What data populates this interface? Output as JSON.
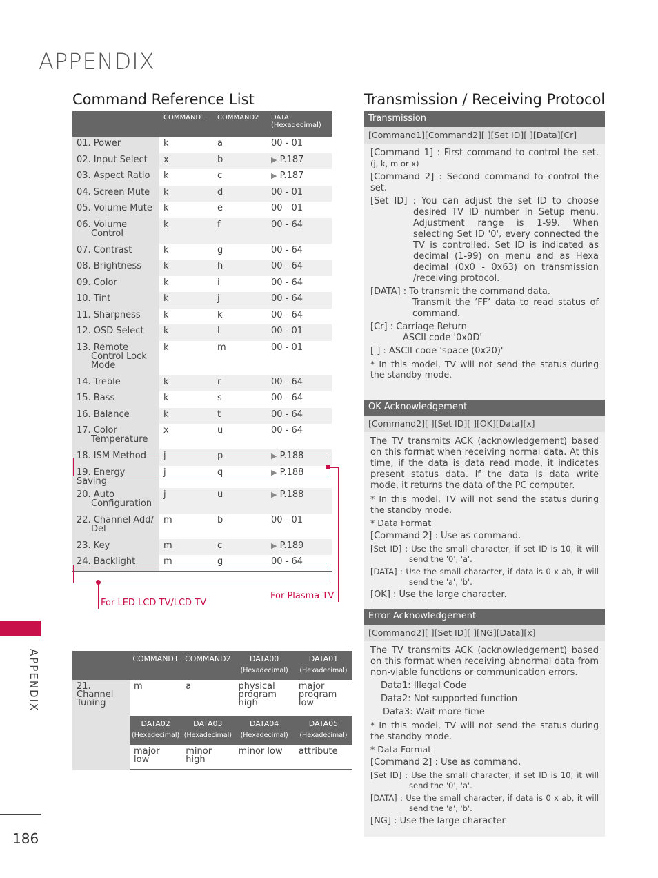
{
  "page": {
    "title": "APPENDIX",
    "side_tab": "APPENDIX",
    "page_number": "186",
    "accent_color": "#c8104a"
  },
  "command_reference": {
    "title": "Command Reference List",
    "headers": [
      "",
      "COMMAND1",
      "COMMAND2",
      "DATA",
      "(Hexadecimal)"
    ],
    "rows": [
      {
        "name": "01. Power",
        "cont": "",
        "c1": "k",
        "c2": "a",
        "data": "00 - 01",
        "ref": false
      },
      {
        "name": "02. Input Select",
        "cont": "",
        "c1": "x",
        "c2": "b",
        "data": "P.187",
        "ref": true
      },
      {
        "name": "03. Aspect Ratio",
        "cont": "",
        "c1": "k",
        "c2": "c",
        "data": "P.187",
        "ref": true
      },
      {
        "name": "04. Screen Mute",
        "cont": "",
        "c1": "k",
        "c2": "d",
        "data": "00 - 01",
        "ref": false
      },
      {
        "name": "05. Volume Mute",
        "cont": "",
        "c1": "k",
        "c2": "e",
        "data": "00 - 01",
        "ref": false
      },
      {
        "name": "06. Volume",
        "cont": "Control",
        "c1": "k",
        "c2": "f",
        "data": "00 - 64",
        "ref": false
      },
      {
        "name": "07. Contrast",
        "cont": "",
        "c1": "k",
        "c2": "g",
        "data": "00 - 64",
        "ref": false
      },
      {
        "name": "08. Brightness",
        "cont": "",
        "c1": "k",
        "c2": "h",
        "data": "00 - 64",
        "ref": false
      },
      {
        "name": "09. Color",
        "cont": "",
        "c1": "k",
        "c2": "i",
        "data": "00 - 64",
        "ref": false
      },
      {
        "name": "10. Tint",
        "cont": "",
        "c1": "k",
        "c2": "j",
        "data": "00 - 64",
        "ref": false
      },
      {
        "name": "11. Sharpness",
        "cont": "",
        "c1": "k",
        "c2": "k",
        "data": "00 - 64",
        "ref": false
      },
      {
        "name": "12. OSD Select",
        "cont": "",
        "c1": "k",
        "c2": "l",
        "data": "00 - 01",
        "ref": false
      },
      {
        "name": "13. Remote",
        "cont": "Control Lock Mode",
        "c1": "k",
        "c2": "m",
        "data": "00 - 01",
        "ref": false
      },
      {
        "name": "14. Treble",
        "cont": "",
        "c1": "k",
        "c2": "r",
        "data": "00 - 64",
        "ref": false
      },
      {
        "name": "15. Bass",
        "cont": "",
        "c1": "k",
        "c2": "s",
        "data": "00 - 64",
        "ref": false
      },
      {
        "name": "16. Balance",
        "cont": "",
        "c1": "k",
        "c2": "t",
        "data": "00 - 64",
        "ref": false
      },
      {
        "name": "17. Color",
        "cont": "Temperature",
        "c1": "x",
        "c2": "u",
        "data": "00 - 64",
        "ref": false
      },
      {
        "name": "18. ISM Method",
        "cont": "",
        "c1": "j",
        "c2": "p",
        "data": "P.188",
        "ref": true
      },
      {
        "name": "19. Energy Saving",
        "cont": "",
        "c1": "j",
        "c2": "q",
        "data": "P.188",
        "ref": true
      },
      {
        "name": "20. Auto",
        "cont": "Configuration",
        "c1": "j",
        "c2": "u",
        "data": "P.188",
        "ref": true
      },
      {
        "name": "22. Channel Add/",
        "cont": "Del",
        "c1": "m",
        "c2": "b",
        "data": "00 - 01",
        "ref": false
      },
      {
        "name": "23. Key",
        "cont": "",
        "c1": "m",
        "c2": "c",
        "data": "P.189",
        "ref": true
      },
      {
        "name": "24. Backlight",
        "cont": "",
        "c1": "m",
        "c2": "g",
        "data": "00 - 64",
        "ref": false
      }
    ],
    "note_led": "For LED LCD TV/LCD TV",
    "note_plasma": "For Plasma TV",
    "arrow_glyph": "▶"
  },
  "channel_tuning": {
    "name_lines": [
      "21.",
      "Channel",
      "Tuning"
    ],
    "headers_top": [
      {
        "label": "COMMAND1",
        "sub": ""
      },
      {
        "label": "COMMAND2",
        "sub": ""
      },
      {
        "label": "DATA00",
        "sub": "(Hexadecimal)"
      },
      {
        "label": "DATA01",
        "sub": "(Hexadecimal)"
      }
    ],
    "row_top": [
      "m",
      "a",
      "physical program high",
      "major program low"
    ],
    "headers_bottom": [
      {
        "label": "DATA02",
        "sub": "(Hexadecimal)"
      },
      {
        "label": "DATA03",
        "sub": "(Hexadecimal)"
      },
      {
        "label": "DATA04",
        "sub": "(Hexadecimal)"
      },
      {
        "label": "DATA05",
        "sub": "(Hexadecimal)"
      }
    ],
    "row_bottom": [
      "major low",
      "minor high",
      "minor low",
      "attribute"
    ]
  },
  "protocol": {
    "title": "Transmission / Receiving Protocol",
    "transmission": {
      "header": "Transmission",
      "format": "[Command1][Command2][   ][Set ID][   ][Data][Cr]",
      "cmd1": "[Command 1] : First command to control the set.",
      "cmd1_small": "(j, k, m or x)",
      "cmd2": "[Command 2] : Second command to control the set.",
      "setid": "[Set ID] : You can adjust the set ID to choose desired TV ID number in Setup menu. Adjustment range is 1-99. When selecting Set ID '0', every connected the TV is controlled. Set ID is indicated as decimal (1-99) on menu and as Hexa decimal (0x0 - 0x63) on transmission /receiving protocol.",
      "data1": "[DATA] : To transmit the command data.",
      "data2": "Transmit the ‘FF’ data to read status of command.",
      "cr1": "[Cr] : Carriage Return",
      "cr2": "ASCII code '0x0D'",
      "space": "[    ] : ASCII code 'space (0x20)'",
      "note": "* In this model, TV will not send the status during the standby mode."
    },
    "ok_ack": {
      "header": "OK Acknowledgement",
      "format": "[Command2][   ][Set ID][   ][OK][Data][x]",
      "desc": "The TV transmits ACK (acknowledgement) based on this format when receiving normal data. At this time, if the data is data read mode, it indicates present status data. If the data is data write mode, it returns the data of the PC computer.",
      "note": "* In this model, TV will not send the status during the standby mode.",
      "data_format": "* Data Format",
      "cmd2": "[Command 2] : Use as command.",
      "setid": "[Set ID] : Use the small character, if set ID is 10, it will send the '0', 'a'.",
      "data": "[DATA] : Use the small character, if data is 0 x ab, it will send the 'a', 'b'.",
      "ok": "[OK] : Use the large character."
    },
    "err_ack": {
      "header": "Error Acknowledgement",
      "format": "[Command2][   ][Set ID][   ][NG][Data][x]",
      "desc": "The TV transmits ACK (acknowledgement) based on this format when receiving abnormal data from non-viable functions or communication errors.",
      "data1": "Data1: Illegal Code",
      "data2": "Data2: Not supported function",
      "data3": "Data3: Wait more time",
      "note": "* In this model, TV will not send the status during the standby mode.",
      "data_format": "* Data Format",
      "cmd2": "[Command 2] : Use as command.",
      "setid": "[Set ID] : Use the small character, if set ID is 10, it will send the '0', 'a'.",
      "data": "[DATA] : Use the small character, if data is 0 x ab, it will send the 'a', 'b'.",
      "ng": "[NG] : Use the large character"
    }
  }
}
